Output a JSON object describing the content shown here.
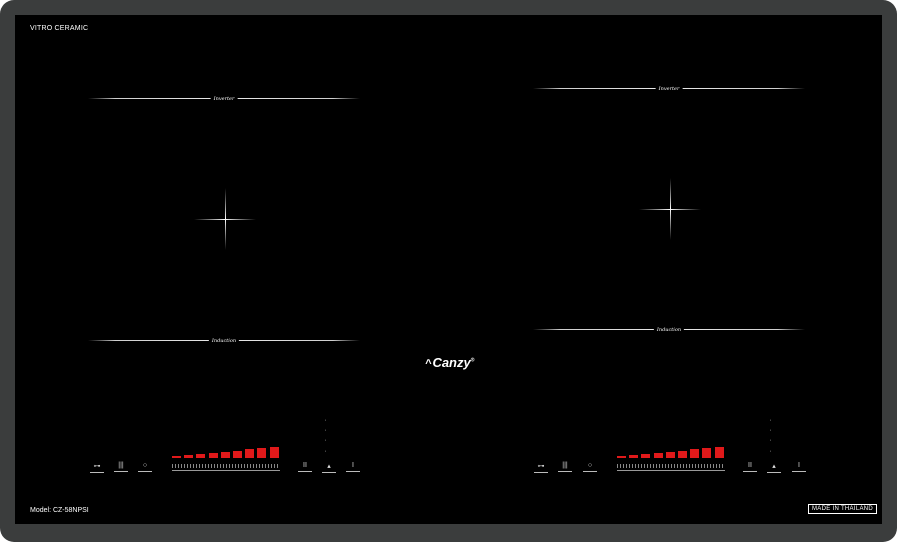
{
  "top_left_label": "VITRO CERAMIC",
  "model_label": "Model: CZ-58NPSI",
  "made_in": "MADE IN THAILAND",
  "brand": "Canzy",
  "zone_script_top": "Inverter",
  "zone_script_bottom": "Induction",
  "icons": {
    "lock": "key-lock-icon",
    "heat": "heat-wave-icon",
    "power": "power-circle-icon",
    "pause": "pause-icon",
    "bridge": "bridge-icon",
    "timer": "timer-icon"
  },
  "colors": {
    "frame": "#3b3d3d",
    "glass": "#000000",
    "heat_bar": "#e0191a"
  },
  "left_panel": {
    "heat_level_fraction": 1.0,
    "bar_count": 9
  },
  "right_panel": {
    "heat_level_fraction": 1.0,
    "bar_count": 9
  }
}
